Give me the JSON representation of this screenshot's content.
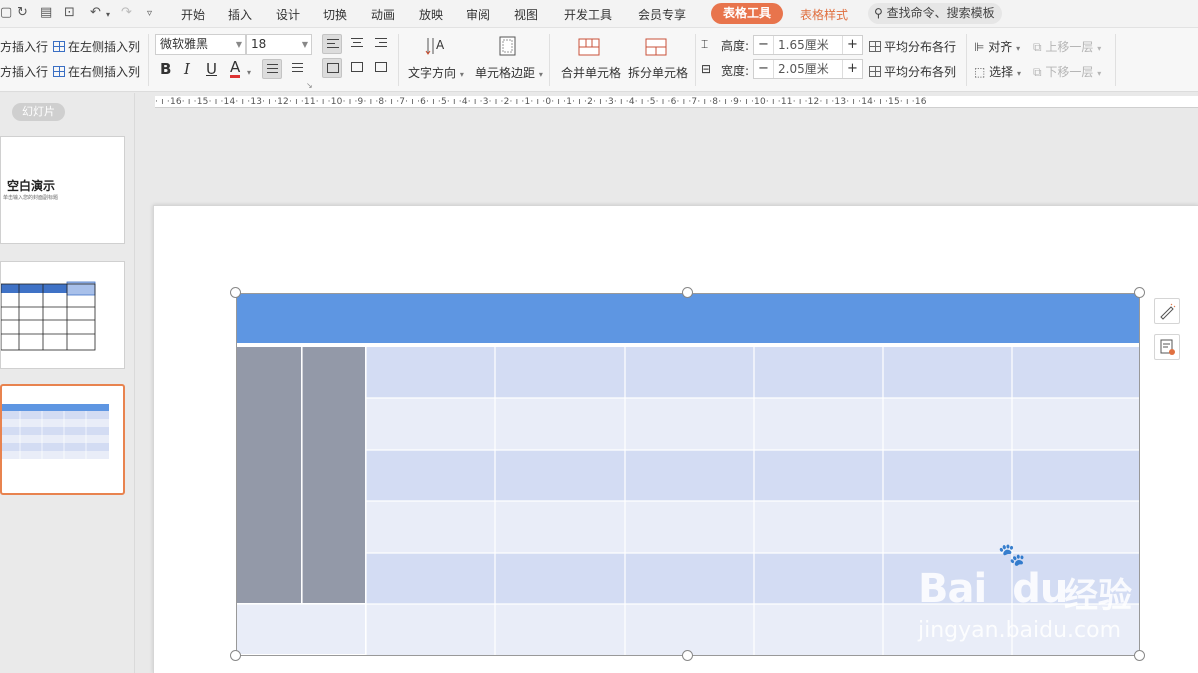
{
  "menu": {
    "tabs": [
      "开始",
      "插入",
      "设计",
      "切换",
      "动画",
      "放映",
      "审阅",
      "视图",
      "开发工具",
      "会员专享"
    ],
    "active_context_tab": "表格工具",
    "context_tab_2": "表格样式",
    "search_placeholder": "查找命令、搜索模板"
  },
  "ribbon": {
    "insert_row_above": "方插入行",
    "insert_row_below": "方插入行",
    "insert_col_left": "在左侧插入列",
    "insert_col_right": "在右侧插入列",
    "font_name": "微软雅黑",
    "font_size": "18",
    "text_direction": "文字方向",
    "cell_margin": "单元格边距",
    "merge_cells": "合并单元格",
    "split_cells": "拆分单元格",
    "height_label": "高度:",
    "height_value": "1.65厘米",
    "width_label": "宽度:",
    "width_value": "2.05厘米",
    "distribute_rows": "平均分布各行",
    "distribute_cols": "平均分布各列",
    "align": "对齐",
    "select": "选择",
    "bring_forward": "上移一层",
    "send_backward": "下移一层"
  },
  "panel": {
    "slides_label": "幻灯片",
    "slide1_title": "空白演示",
    "slide1_subtitle": "单击输入您的封面副标题"
  },
  "ruler": {
    "text": "· ı ·16· ı ·15· ı ·14· ı ·13· ı ·12· ı ·11· ı ·10· ı ·9· ı ·8· ı ·7· ı ·6· ı ·5· ı ·4· ı ·3· ı ·2· ı ·1· ı ·0· ı ·1· ı ·2· ı ·3· ı ·4· ı ·5· ı ·6· ı ·7· ı ·8· ı ·9· ı ·10· ı ·11· ı ·12· ı ·13· ı ·14· ı ·15· ı ·16"
  },
  "watermark": {
    "brand": "Bai",
    "brand2": "du",
    "cn": "经验",
    "url": "jingyan.baidu.com"
  },
  "colors": {
    "accent": "#e8744c",
    "table_header": "#5e96e2",
    "table_band_dark": "#d3dcf3",
    "table_band_light": "#e9edf8",
    "table_grey": "#9399a8"
  }
}
